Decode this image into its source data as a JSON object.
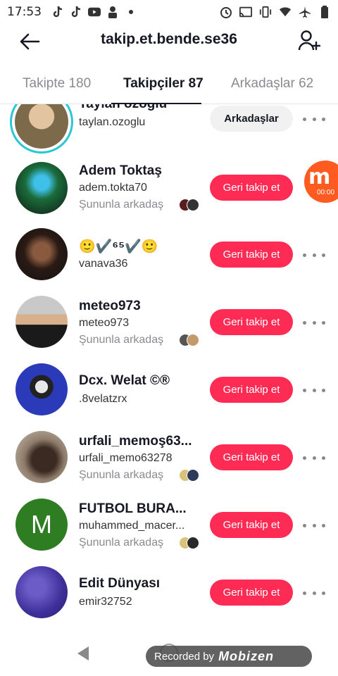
{
  "status_bar": {
    "time": "17:53",
    "left_icons": [
      "tiktok-icon",
      "tiktok-icon",
      "youtube-icon",
      "person-upload-icon",
      "dot-icon"
    ],
    "right_icons": [
      "alarm-icon",
      "cast-icon",
      "vibrate-icon",
      "wifi-icon",
      "airplane-icon",
      "battery-icon"
    ]
  },
  "header": {
    "title": "takip.et.bende.se36"
  },
  "tabs": [
    {
      "label": "Takipte 180",
      "active": false
    },
    {
      "label": "Takipçiler 87",
      "active": true
    },
    {
      "label": "Arkadaşlar 62",
      "active": false
    }
  ],
  "users": [
    {
      "name": "Taylan ozoglu",
      "handle": "taylan.ozoglu",
      "mutual": "",
      "button": "Arkadaşlar",
      "button_type": "friends",
      "avatar_color": "#b9a37e",
      "story_ring": true
    },
    {
      "name": "Adem Toktaş",
      "handle": "adem.tokta70",
      "mutual": "Şununla arkadaş",
      "button": "Geri takip et",
      "button_type": "follow",
      "avatar_color": "#1b3b2a"
    },
    {
      "name": "🙂✔️⁶⁵✔️🙂",
      "handle": "vanava36",
      "mutual": "",
      "button": "Geri takip et",
      "button_type": "follow",
      "avatar_color": "#3a2a22"
    },
    {
      "name": "meteo973",
      "handle": "meteo973",
      "mutual": "Şununla arkadaş",
      "button": "Geri takip et",
      "button_type": "follow",
      "avatar_color": "#8a8f96"
    },
    {
      "name": "Dcx. Welat ©®",
      "handle": ".8velatzrx",
      "mutual": "",
      "button": "Geri takip et",
      "button_type": "follow",
      "avatar_color": "#2733a8"
    },
    {
      "name": "urfali_memoş63...",
      "handle": "urfali_memo63278",
      "mutual": "Şununla arkadaş",
      "button": "Geri takip et",
      "button_type": "follow",
      "avatar_color": "#7b6a5c"
    },
    {
      "name": "FUTBOL BURA...",
      "handle": "muhammed_macer...",
      "mutual": "Şununla arkadaş",
      "button": "Geri takip et",
      "button_type": "follow",
      "avatar_color": "#2e7d23",
      "avatar_letter": "M"
    },
    {
      "name": "Edit Dünyası",
      "handle": "emir32752",
      "mutual": "",
      "button": "Geri takip et",
      "button_type": "follow",
      "avatar_color": "#4b3aa6"
    }
  ],
  "recorder": {
    "logo": "m",
    "timer": "00:00"
  },
  "watermark": {
    "text": "Recorded by",
    "brand": "Mobizen"
  },
  "colors": {
    "accent": "#fe2c55",
    "story_ring": "#2bc7d6"
  }
}
